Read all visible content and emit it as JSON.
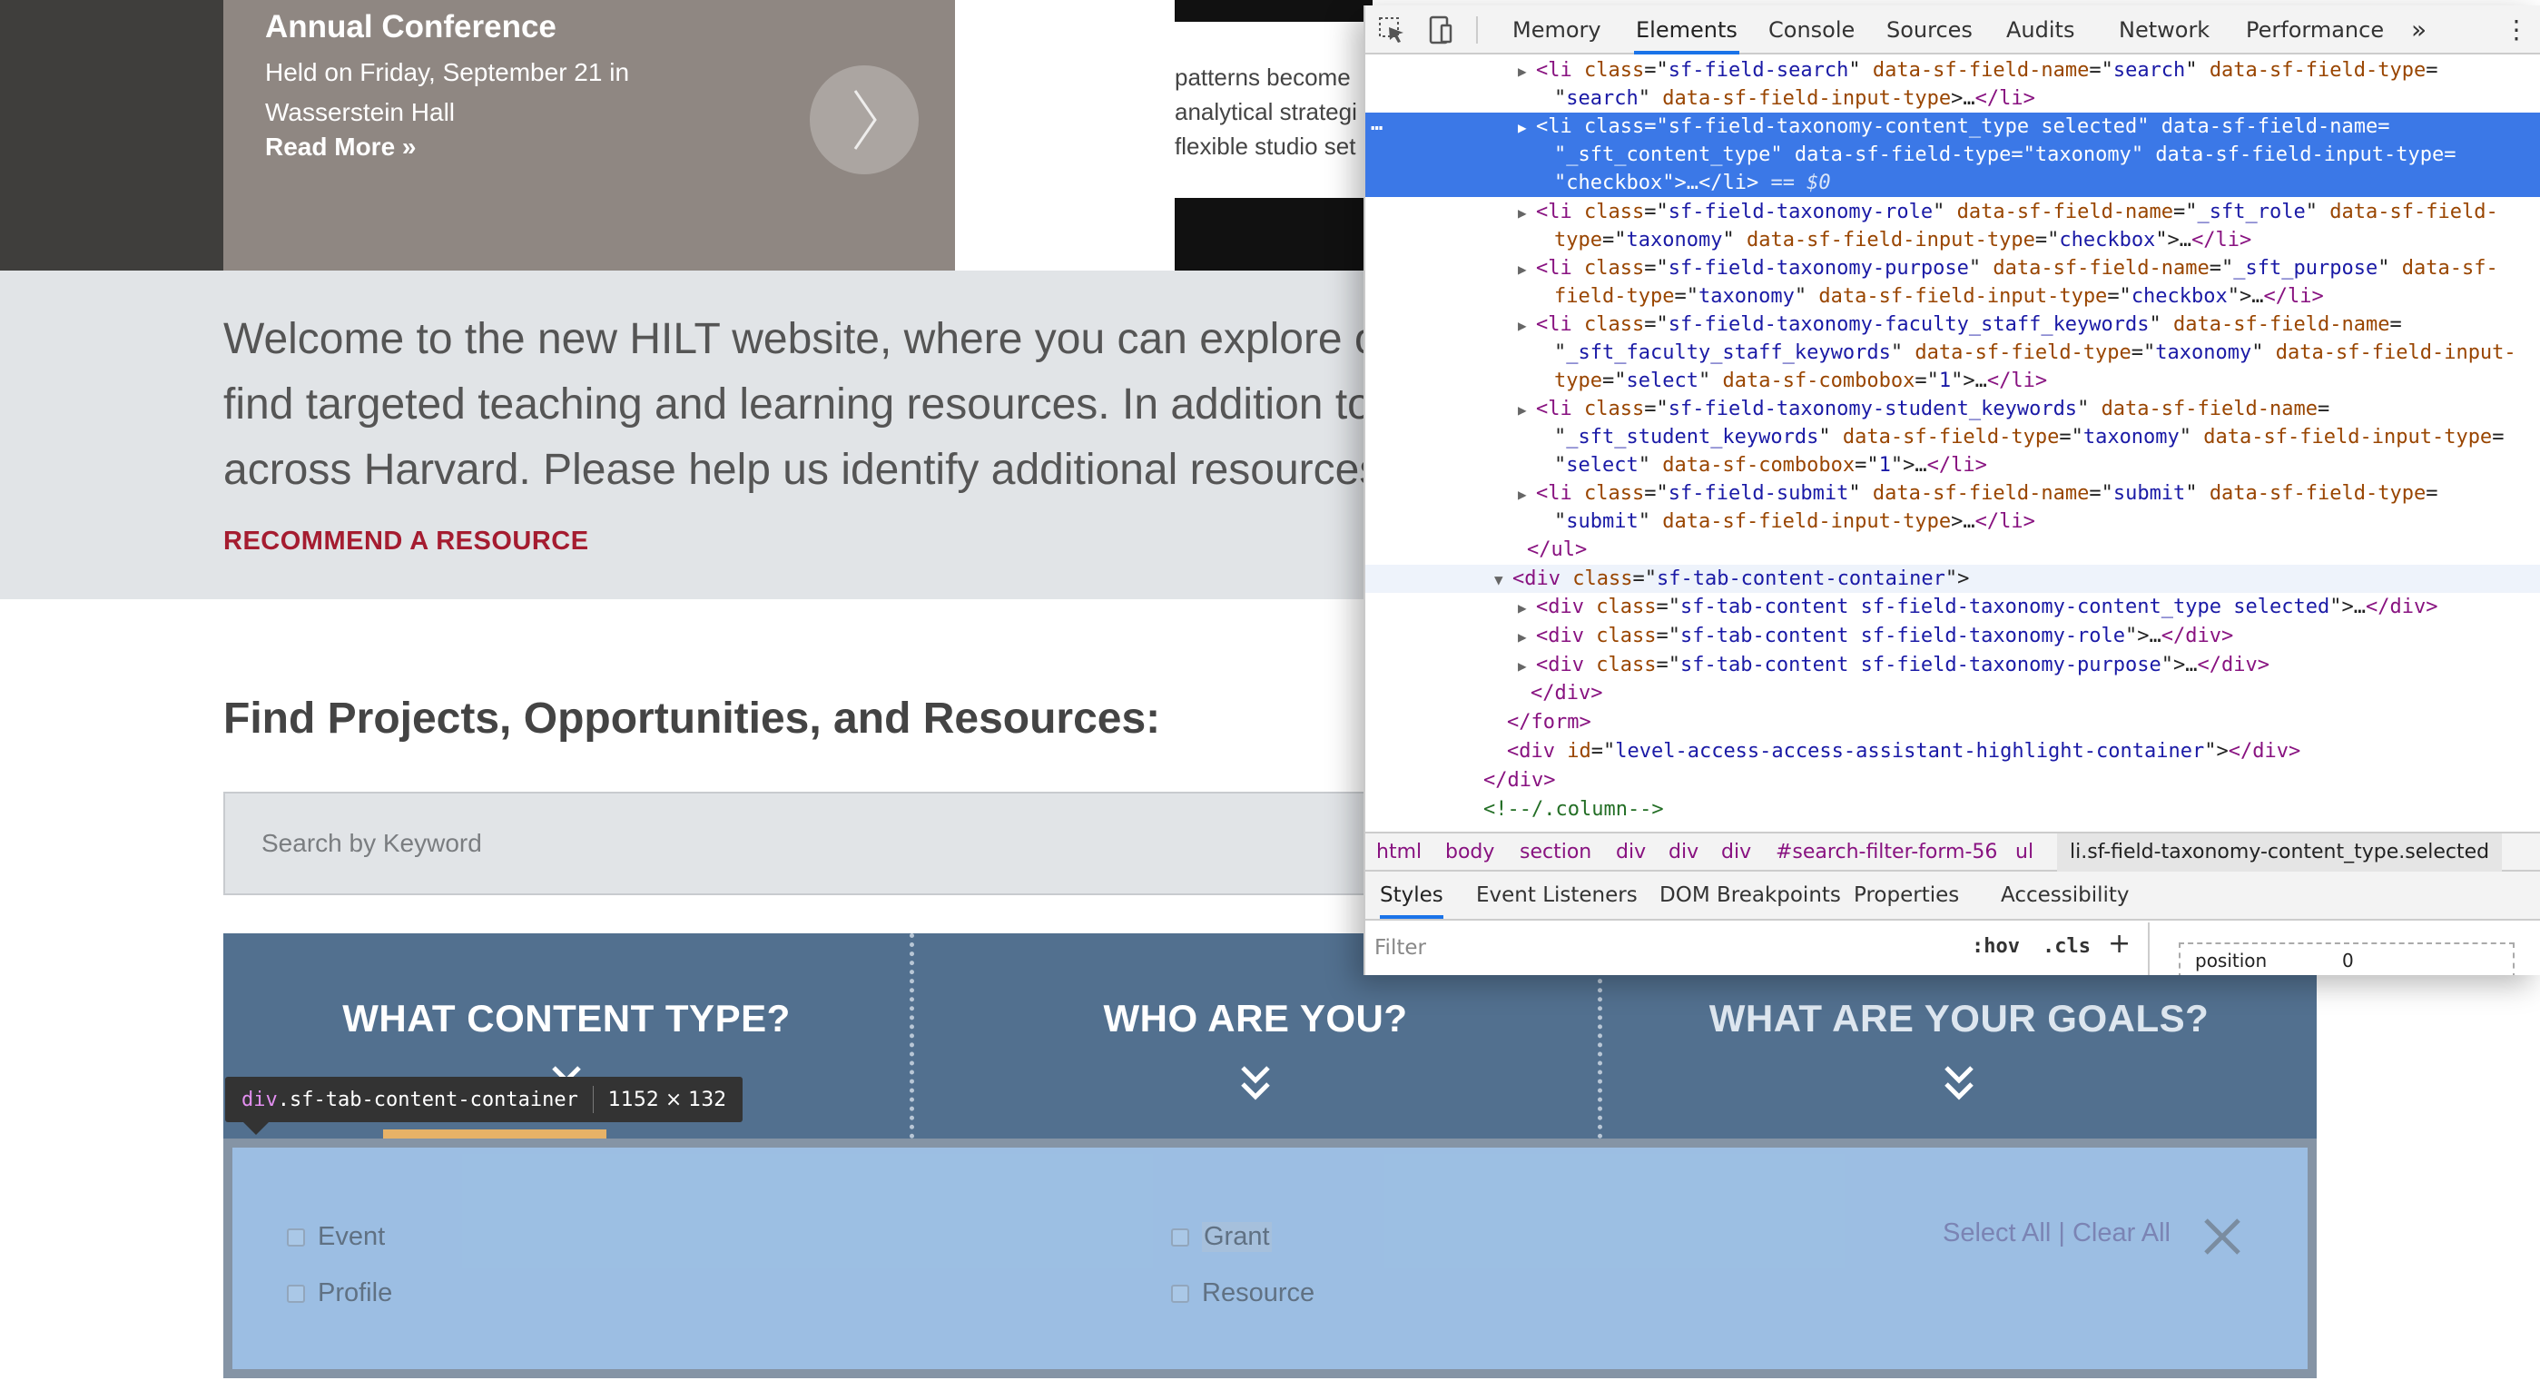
{
  "hero": {
    "title": "Annual Conference",
    "subtitle": "Held on Friday, September 21 in Wasserstein Hall",
    "link": "Read More »",
    "right_text_lines": [
      "patterns become",
      "analytical strategi",
      "flexible studio set"
    ]
  },
  "welcome": {
    "lines": [
      "Welcome to the new HILT website, where you can explore o",
      "find targeted teaching and learning resources. In addition to",
      "across Harvard. Please help us identify additional resources"
    ],
    "recommend_link": "RECOMMEND A RESOURCE"
  },
  "find": {
    "heading": "Find Projects, Opportunities, and Resources:",
    "search_placeholder": "Search by Keyword"
  },
  "filter_tabs": [
    {
      "label": "WHAT CONTENT TYPE?",
      "icon": "chevron-double-down-icon"
    },
    {
      "label": "WHO ARE YOU?",
      "icon": "chevron-double-down-icon"
    },
    {
      "label": "WHAT ARE YOUR GOALS?",
      "icon": "chevron-double-down-icon"
    }
  ],
  "content_options": [
    "Event",
    "Profile",
    "Grant",
    "Resource"
  ],
  "select_all": "Select All",
  "clear_separator": "|",
  "clear_all": "Clear All",
  "inspect_tooltip": {
    "tag": "div",
    "class_name": ".sf-tab-content-container",
    "dims": "1152 × 132"
  },
  "devtools": {
    "tabs": [
      "Memory",
      "Elements",
      "Console",
      "Sources",
      "Audits",
      "Network",
      "Performance"
    ],
    "active_tab": "Elements",
    "more": "»",
    "kebab": "⋮",
    "ellipsis": "…",
    "dom_lines": [
      {
        "tri": "▶",
        "tokens": [
          [
            "t",
            "<li "
          ],
          [
            "a",
            "class"
          ],
          [
            "p",
            "=\""
          ],
          [
            "v",
            "sf-field-search"
          ],
          [
            "p",
            "\" "
          ],
          [
            "a",
            "data-sf-field-name"
          ],
          [
            "p",
            "=\""
          ],
          [
            "v",
            "search"
          ],
          [
            "p",
            "\" "
          ],
          [
            "a",
            "data-sf-field-type"
          ],
          [
            "p",
            "="
          ]
        ]
      },
      {
        "tri": "",
        "tokens": [
          [
            "p",
            "\""
          ],
          [
            "v",
            "search"
          ],
          [
            "p",
            "\" "
          ],
          [
            "a",
            "data-sf-field-input-type"
          ],
          [
            "p",
            ">…"
          ],
          [
            "t",
            "</li>"
          ]
        ]
      },
      {
        "tri": "▶",
        "tokens": [
          [
            "t",
            "<li "
          ],
          [
            "a",
            "class"
          ],
          [
            "p",
            "=\""
          ],
          [
            "v",
            "sf-field-taxonomy-content_type selected"
          ],
          [
            "p",
            "\" "
          ],
          [
            "a",
            "data-sf-field-name"
          ],
          [
            "p",
            "="
          ]
        ]
      },
      {
        "tri": "",
        "tokens": [
          [
            "p",
            "\""
          ],
          [
            "v",
            "_sft_content_type"
          ],
          [
            "p",
            "\" "
          ],
          [
            "a",
            "data-sf-field-type"
          ],
          [
            "p",
            "=\""
          ],
          [
            "v",
            "taxonomy"
          ],
          [
            "p",
            "\" "
          ],
          [
            "a",
            "data-sf-field-input-type"
          ],
          [
            "p",
            "="
          ]
        ]
      },
      {
        "tri": "",
        "tokens": [
          [
            "p",
            "\""
          ],
          [
            "v",
            "checkbox"
          ],
          [
            "p",
            "\">…"
          ],
          [
            "t",
            "</li>"
          ],
          [
            "e",
            " == $0"
          ]
        ]
      },
      {
        "tri": "▶",
        "tokens": [
          [
            "t",
            "<li "
          ],
          [
            "a",
            "class"
          ],
          [
            "p",
            "=\""
          ],
          [
            "v",
            "sf-field-taxonomy-role"
          ],
          [
            "p",
            "\" "
          ],
          [
            "a",
            "data-sf-field-name"
          ],
          [
            "p",
            "=\""
          ],
          [
            "v",
            "_sft_role"
          ],
          [
            "p",
            "\" "
          ],
          [
            "a",
            "data-sf-field-"
          ]
        ]
      },
      {
        "tri": "",
        "tokens": [
          [
            "a",
            "type"
          ],
          [
            "p",
            "=\""
          ],
          [
            "v",
            "taxonomy"
          ],
          [
            "p",
            "\" "
          ],
          [
            "a",
            "data-sf-field-input-type"
          ],
          [
            "p",
            "=\""
          ],
          [
            "v",
            "checkbox"
          ],
          [
            "p",
            "\">…"
          ],
          [
            "t",
            "</li>"
          ]
        ]
      },
      {
        "tri": "▶",
        "tokens": [
          [
            "t",
            "<li "
          ],
          [
            "a",
            "class"
          ],
          [
            "p",
            "=\""
          ],
          [
            "v",
            "sf-field-taxonomy-purpose"
          ],
          [
            "p",
            "\" "
          ],
          [
            "a",
            "data-sf-field-name"
          ],
          [
            "p",
            "=\""
          ],
          [
            "v",
            "_sft_purpose"
          ],
          [
            "p",
            "\" "
          ],
          [
            "a",
            "data-sf-"
          ]
        ]
      },
      {
        "tri": "",
        "tokens": [
          [
            "a",
            "field-type"
          ],
          [
            "p",
            "=\""
          ],
          [
            "v",
            "taxonomy"
          ],
          [
            "p",
            "\" "
          ],
          [
            "a",
            "data-sf-field-input-type"
          ],
          [
            "p",
            "=\""
          ],
          [
            "v",
            "checkbox"
          ],
          [
            "p",
            "\">…"
          ],
          [
            "t",
            "</li>"
          ]
        ]
      },
      {
        "tri": "▶",
        "tokens": [
          [
            "t",
            "<li "
          ],
          [
            "a",
            "class"
          ],
          [
            "p",
            "=\""
          ],
          [
            "v",
            "sf-field-taxonomy-faculty_staff_keywords"
          ],
          [
            "p",
            "\" "
          ],
          [
            "a",
            "data-sf-field-name"
          ],
          [
            "p",
            "="
          ]
        ]
      },
      {
        "tri": "",
        "tokens": [
          [
            "p",
            "\""
          ],
          [
            "v",
            "_sft_faculty_staff_keywords"
          ],
          [
            "p",
            "\" "
          ],
          [
            "a",
            "data-sf-field-type"
          ],
          [
            "p",
            "=\""
          ],
          [
            "v",
            "taxonomy"
          ],
          [
            "p",
            "\" "
          ],
          [
            "a",
            "data-sf-field-input-"
          ]
        ]
      },
      {
        "tri": "",
        "tokens": [
          [
            "a",
            "type"
          ],
          [
            "p",
            "=\""
          ],
          [
            "v",
            "select"
          ],
          [
            "p",
            "\" "
          ],
          [
            "a",
            "data-sf-combobox"
          ],
          [
            "p",
            "=\""
          ],
          [
            "v",
            "1"
          ],
          [
            "p",
            "\">…"
          ],
          [
            "t",
            "</li>"
          ]
        ]
      },
      {
        "tri": "▶",
        "tokens": [
          [
            "t",
            "<li "
          ],
          [
            "a",
            "class"
          ],
          [
            "p",
            "=\""
          ],
          [
            "v",
            "sf-field-taxonomy-student_keywords"
          ],
          [
            "p",
            "\" "
          ],
          [
            "a",
            "data-sf-field-name"
          ],
          [
            "p",
            "="
          ]
        ]
      },
      {
        "tri": "",
        "tokens": [
          [
            "p",
            "\""
          ],
          [
            "v",
            "_sft_student_keywords"
          ],
          [
            "p",
            "\" "
          ],
          [
            "a",
            "data-sf-field-type"
          ],
          [
            "p",
            "=\""
          ],
          [
            "v",
            "taxonomy"
          ],
          [
            "p",
            "\" "
          ],
          [
            "a",
            "data-sf-field-input-type"
          ],
          [
            "p",
            "="
          ]
        ]
      },
      {
        "tri": "",
        "tokens": [
          [
            "p",
            "\""
          ],
          [
            "v",
            "select"
          ],
          [
            "p",
            "\" "
          ],
          [
            "a",
            "data-sf-combobox"
          ],
          [
            "p",
            "=\""
          ],
          [
            "v",
            "1"
          ],
          [
            "p",
            "\">…"
          ],
          [
            "t",
            "</li>"
          ]
        ]
      },
      {
        "tri": "▶",
        "tokens": [
          [
            "t",
            "<li "
          ],
          [
            "a",
            "class"
          ],
          [
            "p",
            "=\""
          ],
          [
            "v",
            "sf-field-submit"
          ],
          [
            "p",
            "\" "
          ],
          [
            "a",
            "data-sf-field-name"
          ],
          [
            "p",
            "=\""
          ],
          [
            "v",
            "submit"
          ],
          [
            "p",
            "\" "
          ],
          [
            "a",
            "data-sf-field-type"
          ],
          [
            "p",
            "="
          ]
        ]
      },
      {
        "tri": "",
        "tokens": [
          [
            "p",
            "\""
          ],
          [
            "v",
            "submit"
          ],
          [
            "p",
            "\" "
          ],
          [
            "a",
            "data-sf-field-input-type"
          ],
          [
            "p",
            ">…"
          ],
          [
            "t",
            "</li>"
          ]
        ]
      },
      {
        "tri": "",
        "tokens": [
          [
            "t",
            "</ul>"
          ]
        ]
      },
      {
        "tri": "▼",
        "tokens": [
          [
            "t",
            "<div "
          ],
          [
            "a",
            "class"
          ],
          [
            "p",
            "=\""
          ],
          [
            "v",
            "sf-tab-content-container"
          ],
          [
            "p",
            "\">"
          ]
        ]
      },
      {
        "tri": "▶",
        "tokens": [
          [
            "t",
            "<div "
          ],
          [
            "a",
            "class"
          ],
          [
            "p",
            "=\""
          ],
          [
            "v",
            "sf-tab-content sf-field-taxonomy-content_type selected"
          ],
          [
            "p",
            "\">…"
          ],
          [
            "t",
            "</div>"
          ]
        ]
      },
      {
        "tri": "▶",
        "tokens": [
          [
            "t",
            "<div "
          ],
          [
            "a",
            "class"
          ],
          [
            "p",
            "=\""
          ],
          [
            "v",
            "sf-tab-content sf-field-taxonomy-role"
          ],
          [
            "p",
            "\">…"
          ],
          [
            "t",
            "</div>"
          ]
        ]
      },
      {
        "tri": "▶",
        "tokens": [
          [
            "t",
            "<div "
          ],
          [
            "a",
            "class"
          ],
          [
            "p",
            "=\""
          ],
          [
            "v",
            "sf-tab-content sf-field-taxonomy-purpose"
          ],
          [
            "p",
            "\">…"
          ],
          [
            "t",
            "</div>"
          ]
        ]
      },
      {
        "tri": "",
        "tokens": [
          [
            "t",
            "</div>"
          ]
        ]
      },
      {
        "tri": "",
        "tokens": [
          [
            "t",
            "</form>"
          ]
        ]
      },
      {
        "tri": "",
        "tokens": [
          [
            "t",
            "<div "
          ],
          [
            "a",
            "id"
          ],
          [
            "p",
            "=\""
          ],
          [
            "v",
            "level-access-access-assistant-highlight-container"
          ],
          [
            "p",
            "\">"
          ],
          [
            "t",
            "</div>"
          ]
        ]
      },
      {
        "tri": "",
        "tokens": [
          [
            "t",
            "</div>"
          ]
        ]
      },
      {
        "tri": "",
        "tokens": [
          [
            "c",
            "<!--/.column-->"
          ]
        ]
      }
    ],
    "breadcrumb": [
      "html",
      "body",
      "section",
      "div",
      "div",
      "div",
      "#search-filter-form-56",
      "ul",
      "li.sf-field-taxonomy-content_type.selected"
    ],
    "sub_tabs": [
      "Styles",
      "Event Listeners",
      "DOM Breakpoints",
      "Properties",
      "Accessibility"
    ],
    "active_sub_tab": "Styles",
    "filter_placeholder": "Filter",
    "hov": ":hov",
    "cls": ".cls",
    "plus": "+",
    "box_model": {
      "label": "position",
      "value": "0"
    }
  },
  "colors": {
    "filter_bar": "#52708f",
    "content_panel": "#a6c4e4",
    "recommend": "#a51c30",
    "dom_selected": "#3b78e7",
    "underline": "#e7b267"
  }
}
